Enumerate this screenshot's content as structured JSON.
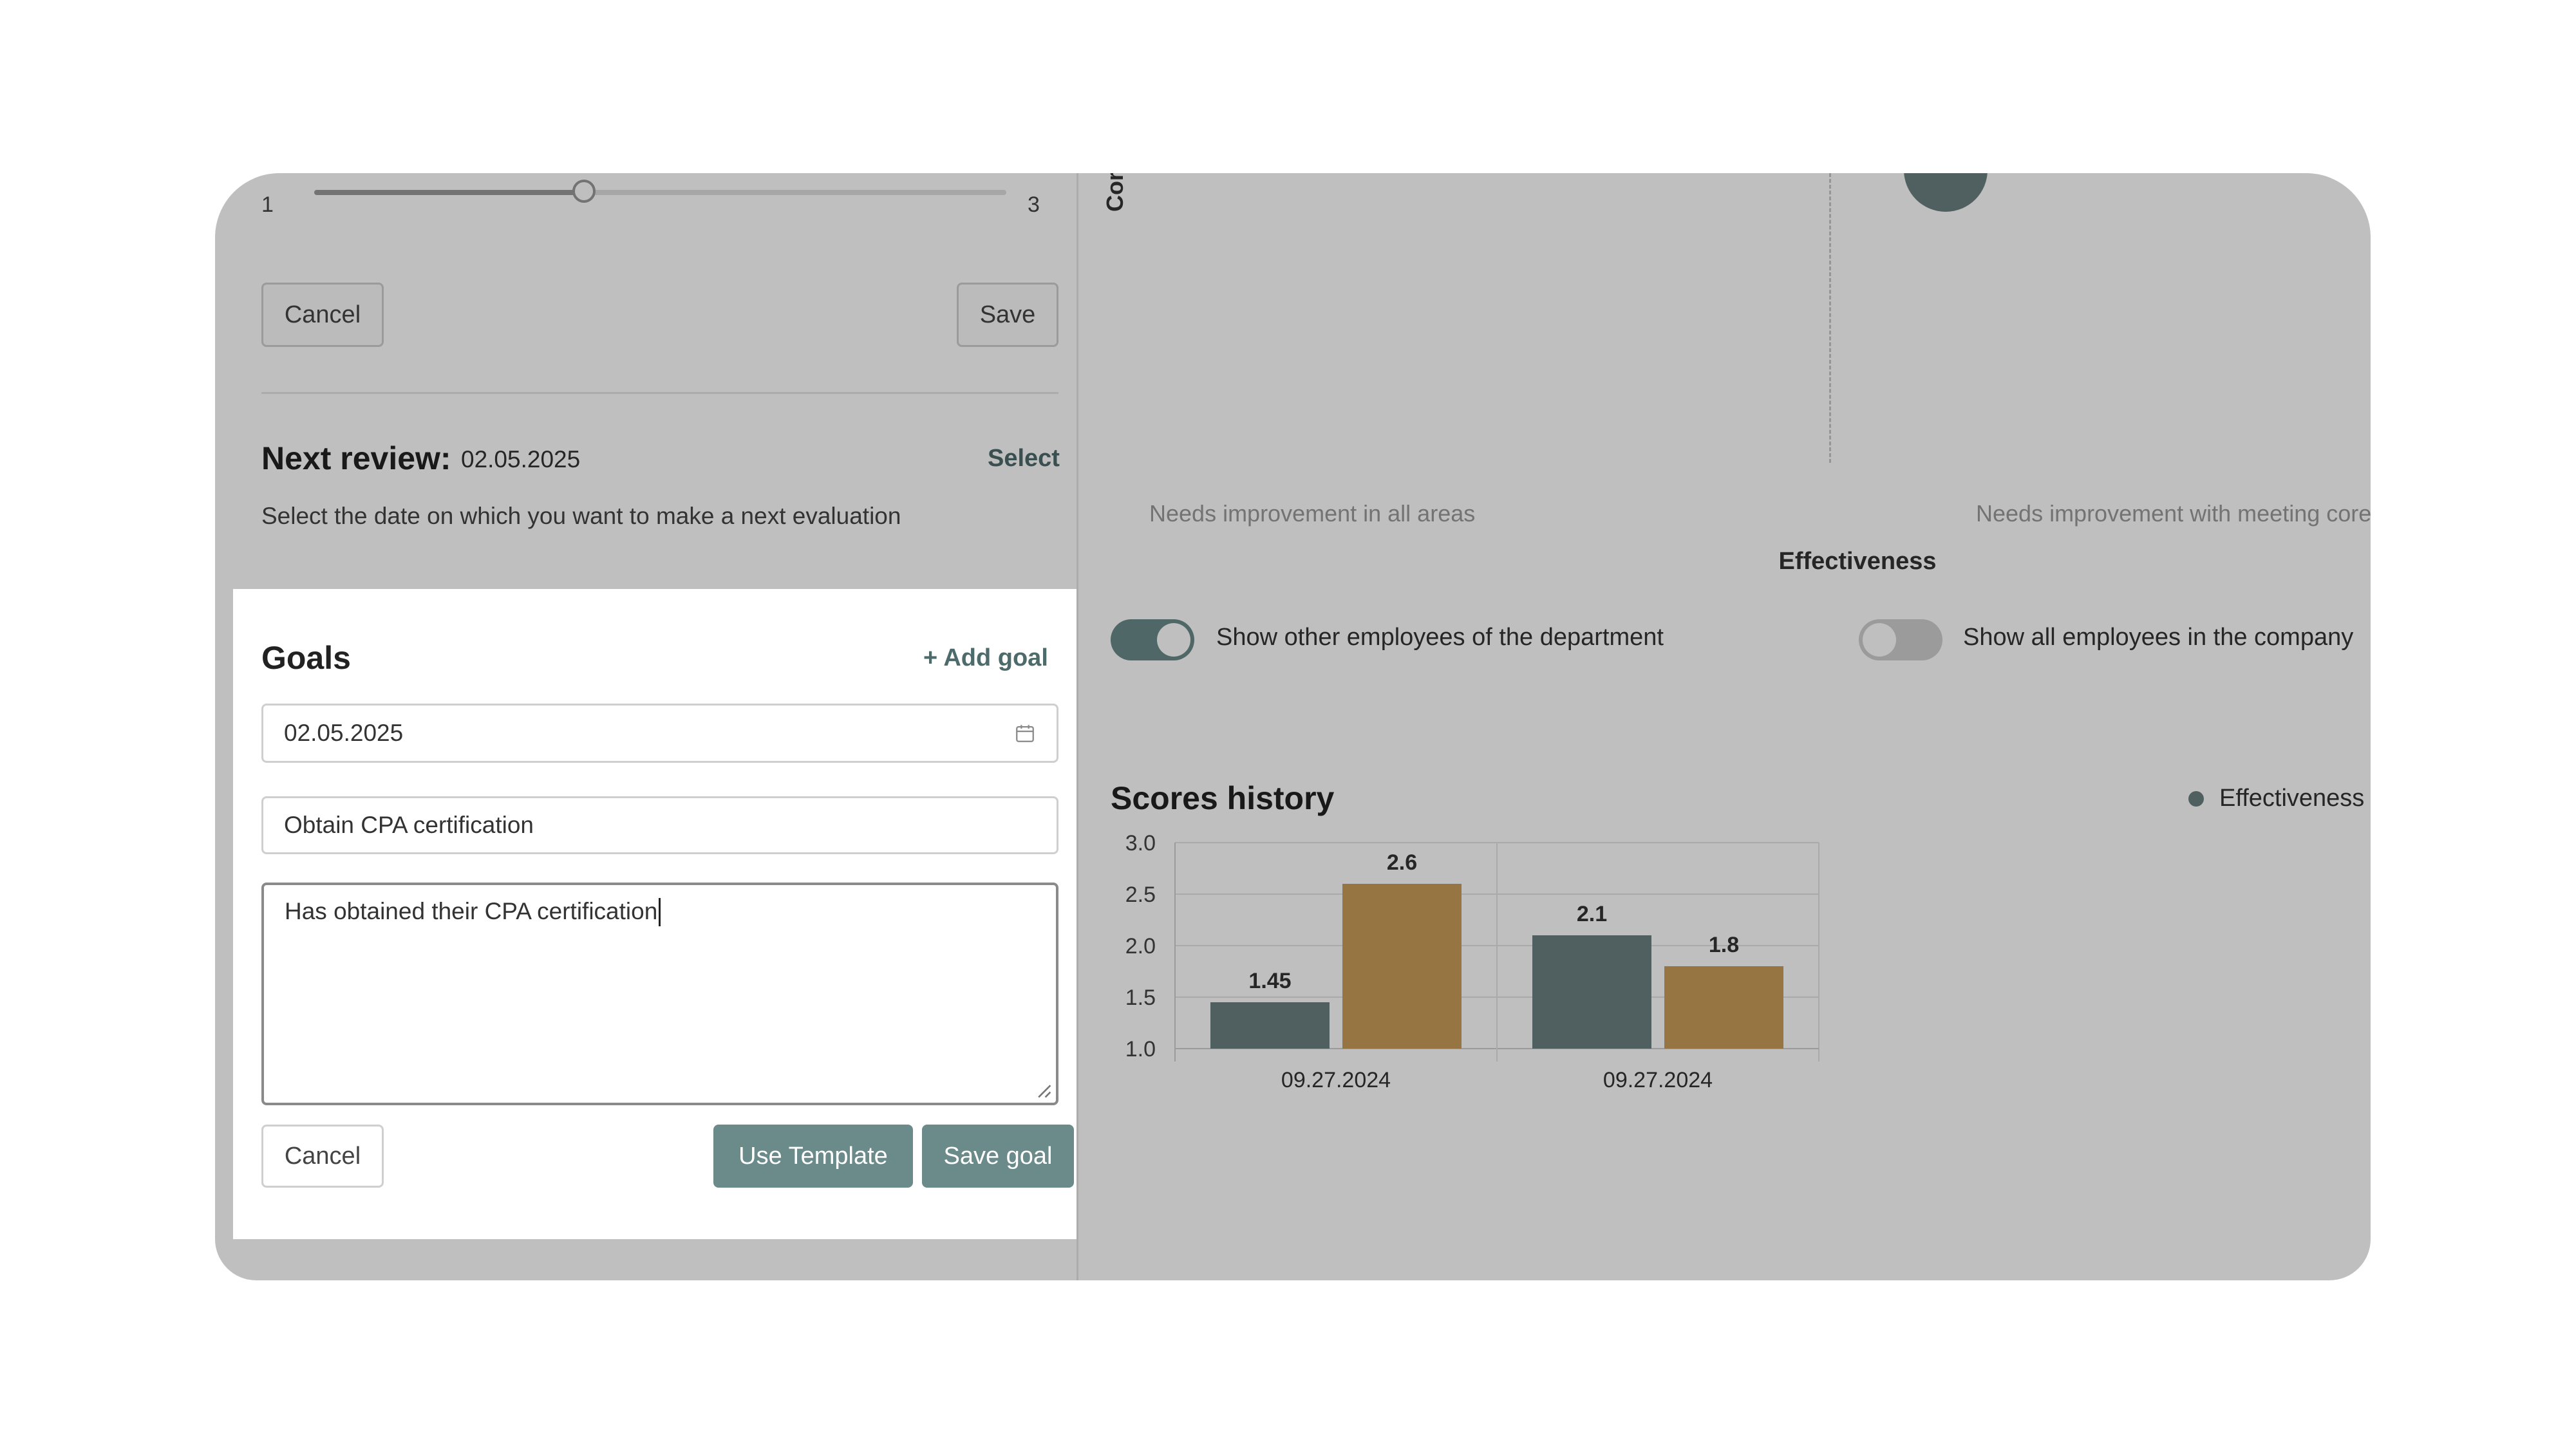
{
  "rating_slider": {
    "min_label": "1",
    "max_label": "3",
    "value_fraction": 0.39
  },
  "rating_actions": {
    "cancel_label": "Cancel",
    "save_label": "Save"
  },
  "next_review": {
    "title": "Next review:",
    "date": "02.05.2025",
    "select_label": "Select",
    "description": "Select the date on which you want to make a next evaluation"
  },
  "goals": {
    "title": "Goals",
    "add_goal_label": "+ Add goal",
    "date_value": "02.05.2025",
    "goal_title_value": "Obtain CPA certification",
    "goal_description_value": "Has obtained their CPA certification",
    "cancel_label": "Cancel",
    "use_template_label": "Use Template",
    "save_goal_label": "Save goal",
    "icons": {
      "date": "calendar-icon",
      "resize": "resize-handle-icon"
    }
  },
  "quadrant": {
    "y_axis_label": "Cor",
    "x_axis_label": "Effectiveness",
    "bottom_left_label": "Needs improvement in all areas",
    "bottom_right_label": "Needs improvement with meeting core"
  },
  "toggles": {
    "department": {
      "label": "Show other employees of the department",
      "on": true
    },
    "company": {
      "label": "Show all employees in the company",
      "on": false
    }
  },
  "scores_history": {
    "title": "Scores history",
    "legend_label": "Effectiveness"
  },
  "colors": {
    "accent": "#6b8a8a",
    "effectiveness_bar": "#6b7f7f",
    "second_bar": "#c89d5a",
    "bubble": "#6b7f7f"
  },
  "chart_data": {
    "type": "bar",
    "categories": [
      "09.27.2024",
      "09.27.2024"
    ],
    "series": [
      {
        "name": "Effectiveness",
        "values": [
          1.45,
          2.1
        ]
      },
      {
        "values": [
          2.6,
          1.8
        ]
      }
    ],
    "data_labels": [
      [
        "1.45",
        "2.6"
      ],
      [
        "2.1",
        "1.8"
      ]
    ],
    "y_ticks": [
      "3.0",
      "2.5",
      "2.0",
      "1.5",
      "1.0"
    ],
    "ylim": [
      1.0,
      3.0
    ],
    "grid": true
  }
}
